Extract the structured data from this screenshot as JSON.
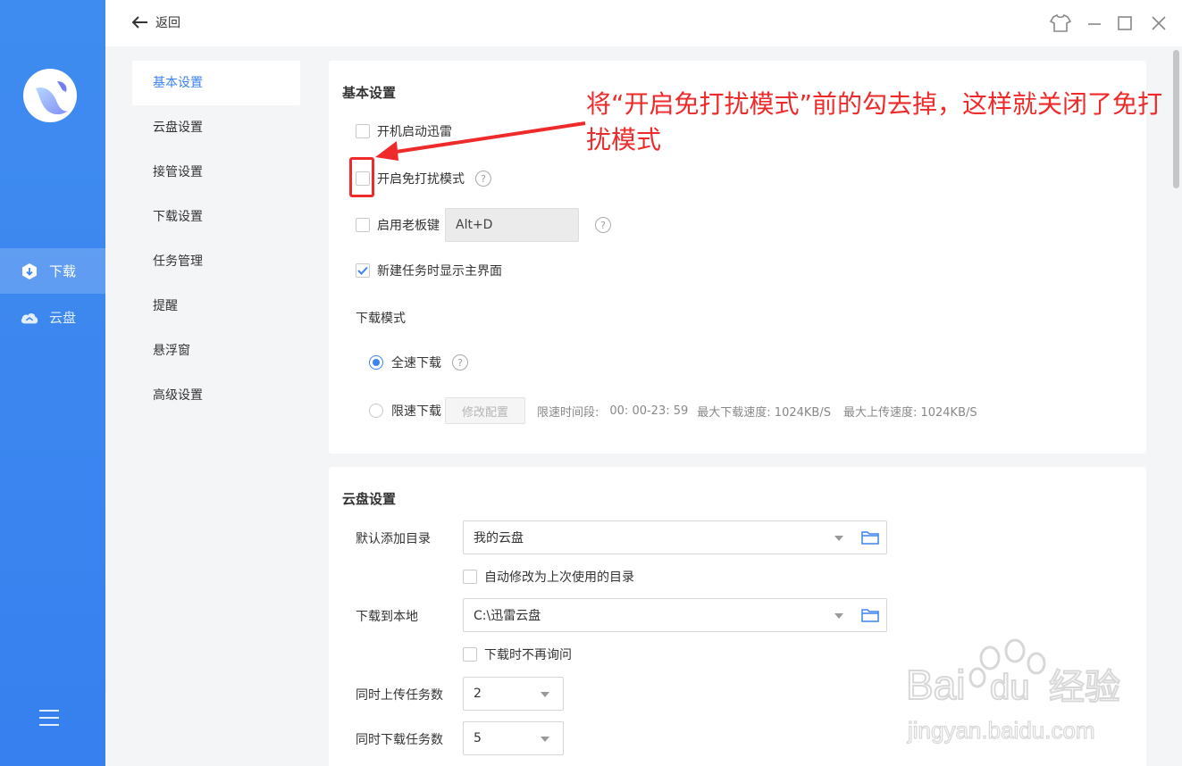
{
  "nav": {
    "items": [
      {
        "label": "下载",
        "icon": "download-icon",
        "active": true
      },
      {
        "label": "云盘",
        "icon": "cloud-icon",
        "active": false
      }
    ]
  },
  "topbar": {
    "back_label": "返回"
  },
  "menu": {
    "items": [
      "基本设置",
      "云盘设置",
      "接管设置",
      "下载设置",
      "任务管理",
      "提醒",
      "悬浮窗",
      "高级设置"
    ]
  },
  "basic": {
    "title": "基本设置",
    "autostart": "开机启动迅雷",
    "dnd": "开启免打扰模式",
    "bosskey": "启用老板键",
    "bosskey_value": "Alt+D",
    "show_main": "新建任务时显示主界面",
    "mode_title": "下载模式",
    "full_speed": "全速下载",
    "limited": "限速下载",
    "modify_btn": "修改配置",
    "limit_period_label": "限速时间段:",
    "limit_period": "00: 00-23: 59",
    "max_down": "最大下载速度: 1024KB/S",
    "max_up": "最大上传速度: 1024KB/S"
  },
  "cloud": {
    "title": "云盘设置",
    "default_dir_label": "默认添加目录",
    "default_dir": "我的云盘",
    "auto_change": "自动修改为上次使用的目录",
    "local_label": "下载到本地",
    "local_dir": "C:\\迅雷云盘",
    "no_ask": "下载时不再询问",
    "upload_label": "同时上传任务数",
    "upload_value": "2",
    "download_label": "同时下载任务数",
    "download_value": "5"
  },
  "annotation": {
    "text": "将“开启免打扰模式”前的勾去掉，这样就关闭了免打扰模式",
    "color": "#ee2a2a"
  },
  "watermark": {
    "brand_a": "Bai",
    "brand_b": "du",
    "brand_c": "经验",
    "url": "jingyan.baidu.com"
  },
  "colors": {
    "sidebar": "#3b86ef",
    "accent": "#3c82f0"
  }
}
